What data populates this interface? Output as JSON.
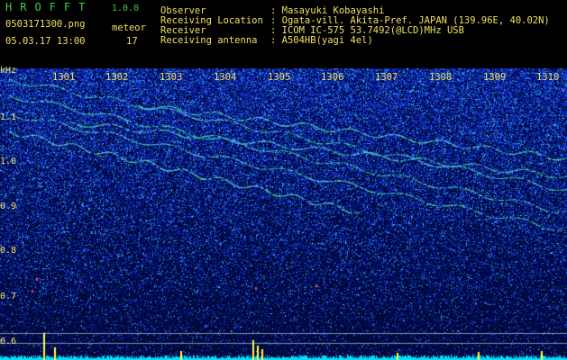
{
  "app": {
    "title": "HROFFT",
    "version": "1.0.0"
  },
  "file": {
    "name": "0503171300.png",
    "meteor_label": "meteor",
    "date": "05.03.17 13:00",
    "meteor_count": "17"
  },
  "info": [
    {
      "label": "Observer",
      "value": ": Masayuki Kobayashi"
    },
    {
      "label": "Receiving Location",
      "value": ": Ogata-vill. Akita-Pref. JAPAN (139.96E, 40.02N)"
    },
    {
      "label": "Receiver",
      "value": ": ICOM IC-575 53.7492(@LCD)MHz USB"
    },
    {
      "label": "Receiving antenna",
      "value": ": A504HB(yagi 4el)"
    }
  ],
  "axis": {
    "unit": "kHz",
    "y_ticks": [
      "1.1",
      "1.0",
      "0.9",
      "0.8",
      "0.7",
      "0.6"
    ],
    "x_ticks": [
      "1301",
      "1302",
      "1303",
      "1304",
      "1305",
      "1306",
      "1307",
      "1308",
      "1309",
      "1310"
    ]
  },
  "colors": {
    "background": "#000000",
    "text": "#f0e060",
    "title": "#3ecf3e",
    "spectrum_low": "#000a4a",
    "spectrum_mid": "#1a3cff",
    "signal": "#40ff70",
    "baseline": "#00e0ff",
    "meteor_burst": "#ffff40"
  }
}
